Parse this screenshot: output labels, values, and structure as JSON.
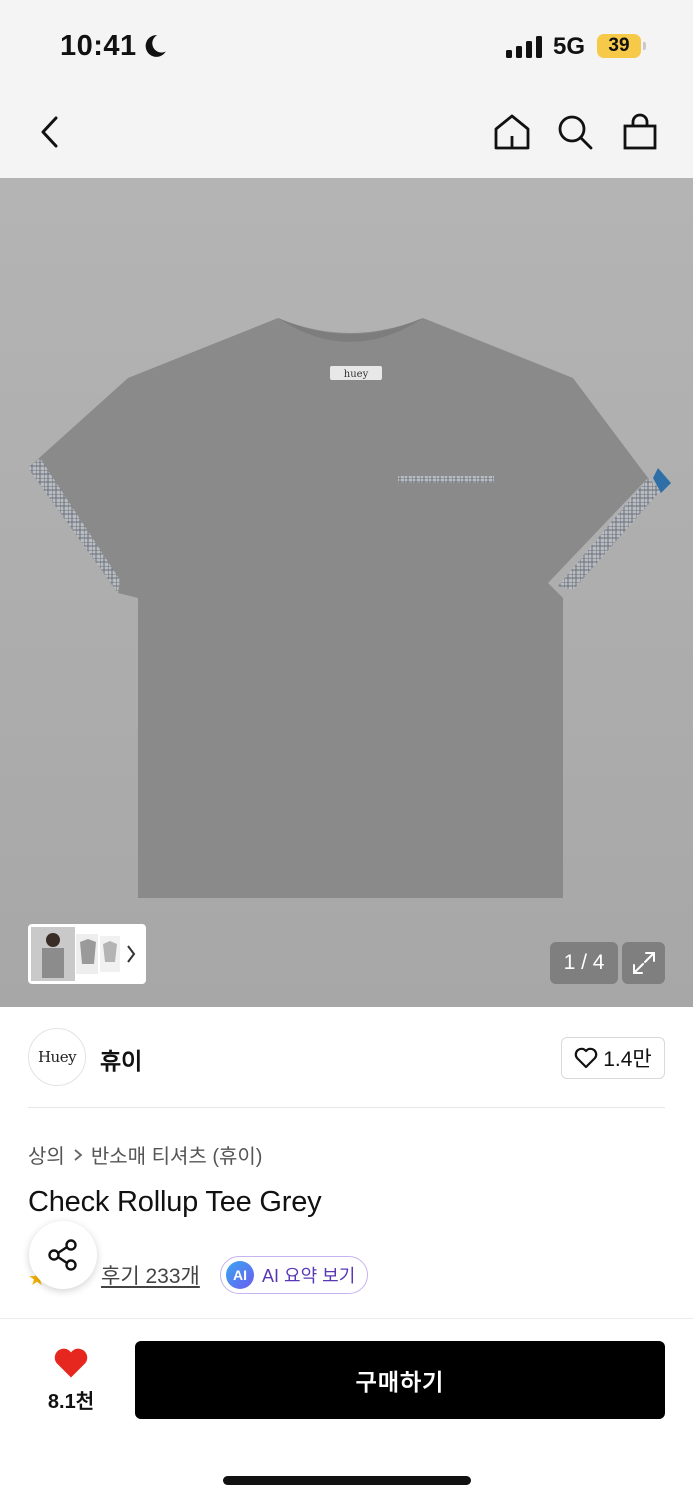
{
  "status_bar": {
    "time": "10:41",
    "network": "5G",
    "battery": "39"
  },
  "brand": {
    "logo_text": "Huey",
    "name": "휴이",
    "likes": "1.4만"
  },
  "gallery": {
    "counter": "1 / 4",
    "label_tag": "huey"
  },
  "breadcrumb": [
    "상의",
    "반소매 티셔츠 (휴이)"
  ],
  "product": {
    "title": "Check Rollup Tee Grey"
  },
  "reviews": {
    "label": "후기 233개"
  },
  "ai_summary": {
    "badge": "AI",
    "label": "AI 요약 보기"
  },
  "bottom_bar": {
    "wish_count": "8.1천",
    "buy_label": "구매하기"
  },
  "colors": {
    "tee": "#8a8a8a",
    "accent_heart": "#e5271f",
    "ai_purple": "#5a38b5",
    "battery": "#f7c948"
  }
}
